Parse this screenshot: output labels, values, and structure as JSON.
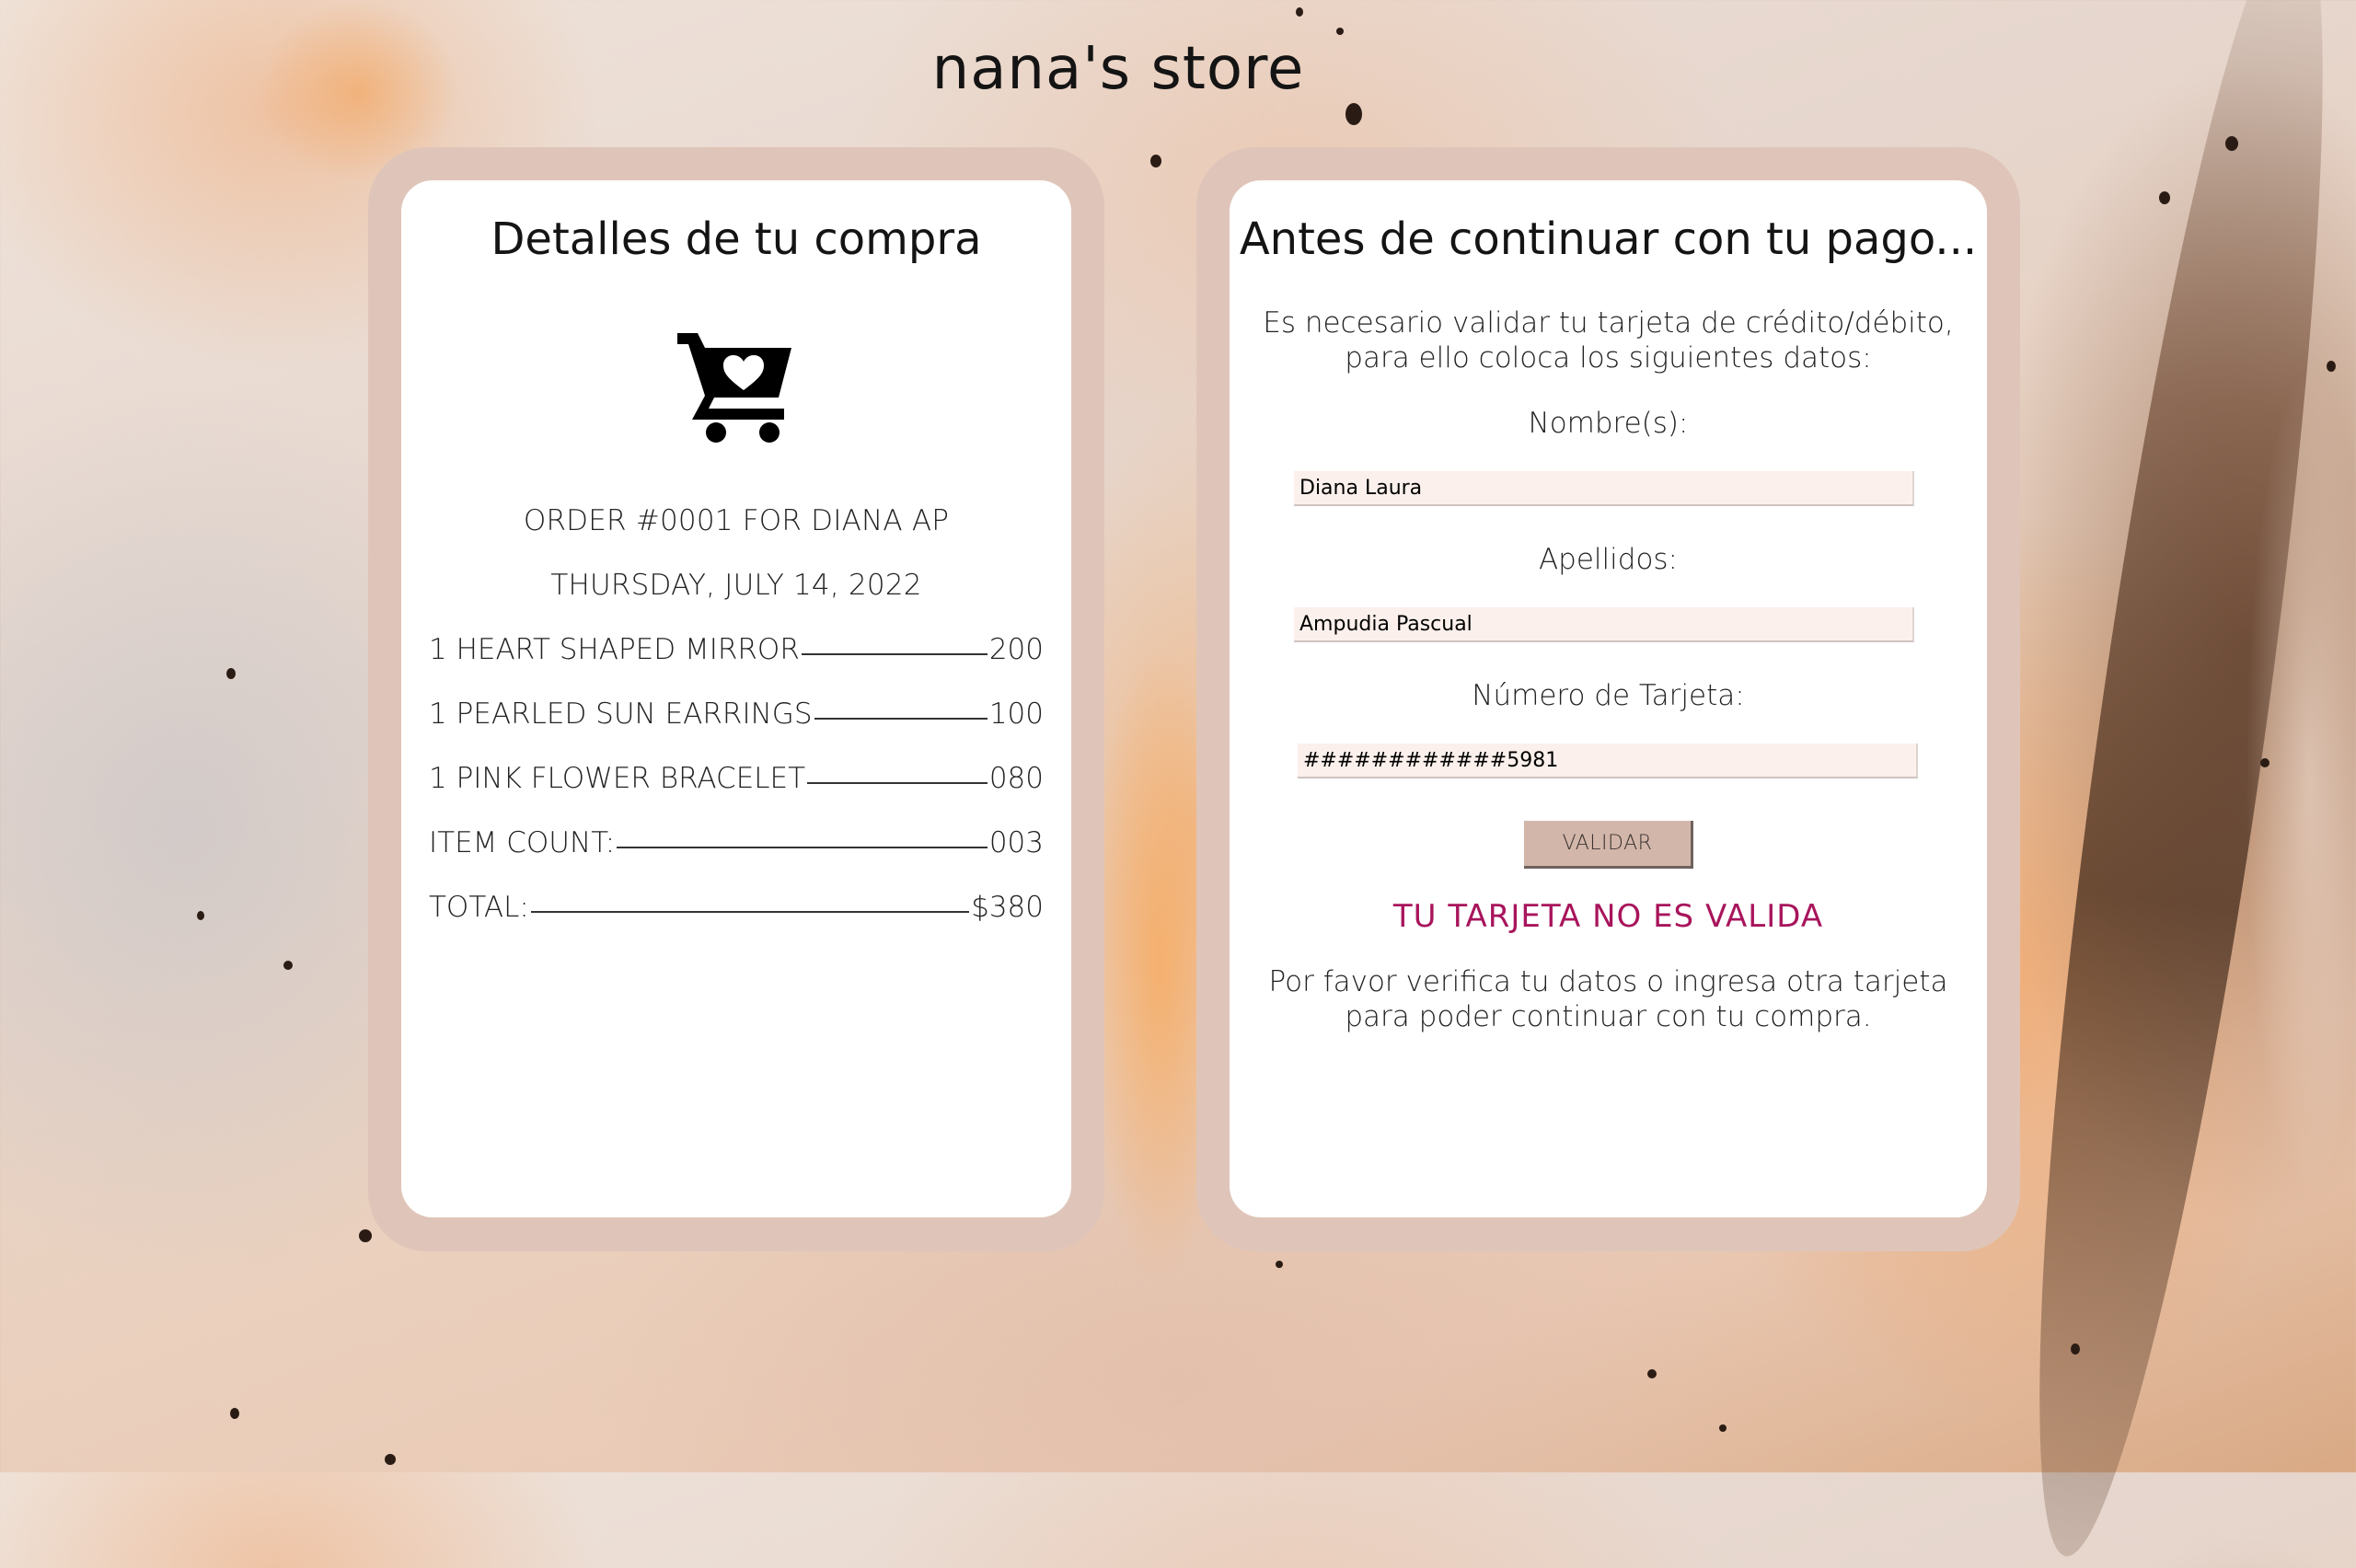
{
  "store": {
    "title": "nana's store"
  },
  "order": {
    "title": "Detalles de tu compra",
    "icon": "shopping-cart-heart-icon",
    "order_line": "ORDER #0001 FOR DIANA AP",
    "date": "THURSDAY, JULY 14, 2022",
    "items": [
      {
        "label": "1 HEART SHAPED MIRROR",
        "amount": "200"
      },
      {
        "label": "1 PEARLED SUN EARRINGS",
        "amount": "100"
      },
      {
        "label": "1 PINK FLOWER BRACELET",
        "amount": "080"
      }
    ],
    "item_count": {
      "label": "ITEM COUNT:",
      "amount": "003"
    },
    "total": {
      "label": "TOTAL:",
      "amount": "$380"
    }
  },
  "payment": {
    "title": "Antes de continuar con tu pago...",
    "intro": "Es necesario validar tu tarjeta de crédito/débito, para ello coloca los siguientes datos:",
    "name_label": "Nombre(s):",
    "name_value": "Diana Laura",
    "surname_label": "Apellidos:",
    "surname_value": "Ampudia Pascual",
    "card_label": "Número de Tarjeta:",
    "card_value": "############5981",
    "validate_label": "VALIDAR",
    "error_message": "TU TARJETA NO ES VALIDA",
    "help_text": "Por favor verifica tu datos o ingresa otra tarjeta para poder continuar con tu compra."
  },
  "colors": {
    "frame": "#dfc5b9",
    "card": "#ffffff",
    "input_bg": "#fbf0eb",
    "button_bg": "#d3b6aa",
    "error": "#a8155c"
  }
}
